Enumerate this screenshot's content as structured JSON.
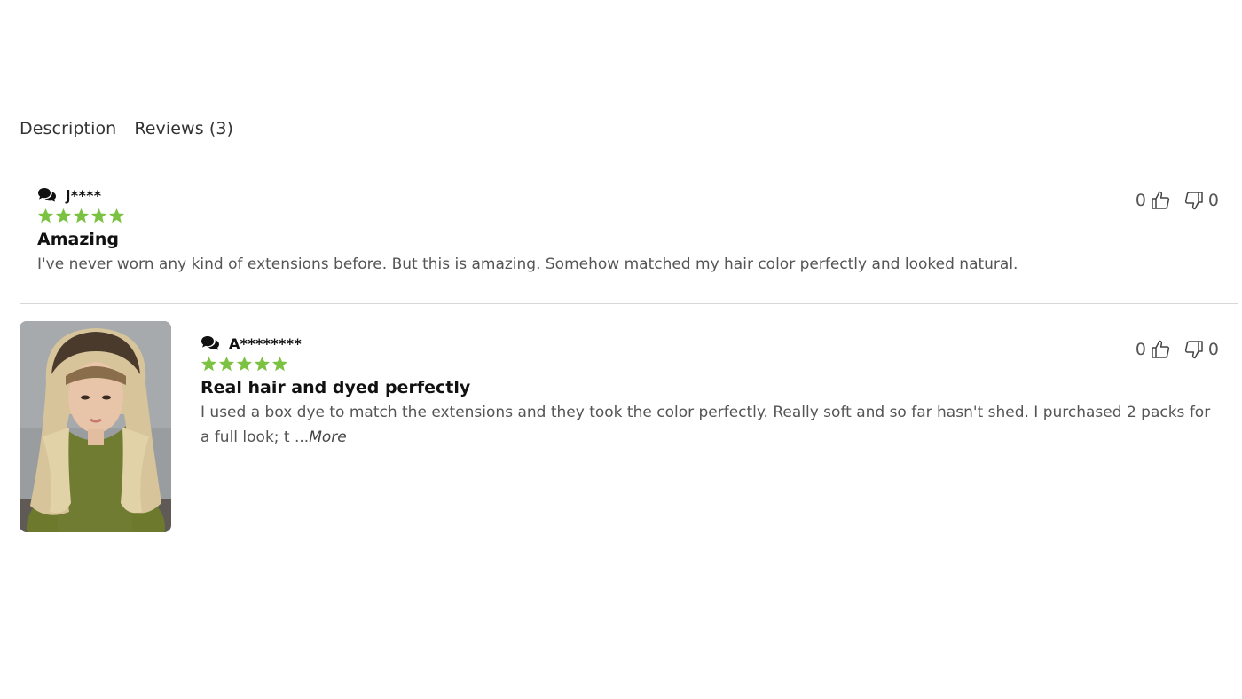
{
  "tabs": [
    {
      "label": "Description"
    },
    {
      "label": "Reviews (3)"
    }
  ],
  "colors": {
    "star": "#7cc242",
    "divider": "#d7d7d7"
  },
  "reviews": [
    {
      "author": "j****",
      "rating": 5,
      "title": "Amazing",
      "text": "I've never worn any kind of extensions before. But this is amazing. Somehow matched my hair color perfectly and looked natural.",
      "more": "",
      "likes": "0",
      "dislikes": "0",
      "has_photo": false
    },
    {
      "author": "A********",
      "rating": 5,
      "title": "Real hair and dyed perfectly",
      "text": "I used a box dye to match the extensions and they took the color perfectly. Really soft and so far hasn't shed. I purchased 2 packs for a full look; t ...",
      "more": "More",
      "likes": "0",
      "dislikes": "0",
      "has_photo": true
    }
  ]
}
